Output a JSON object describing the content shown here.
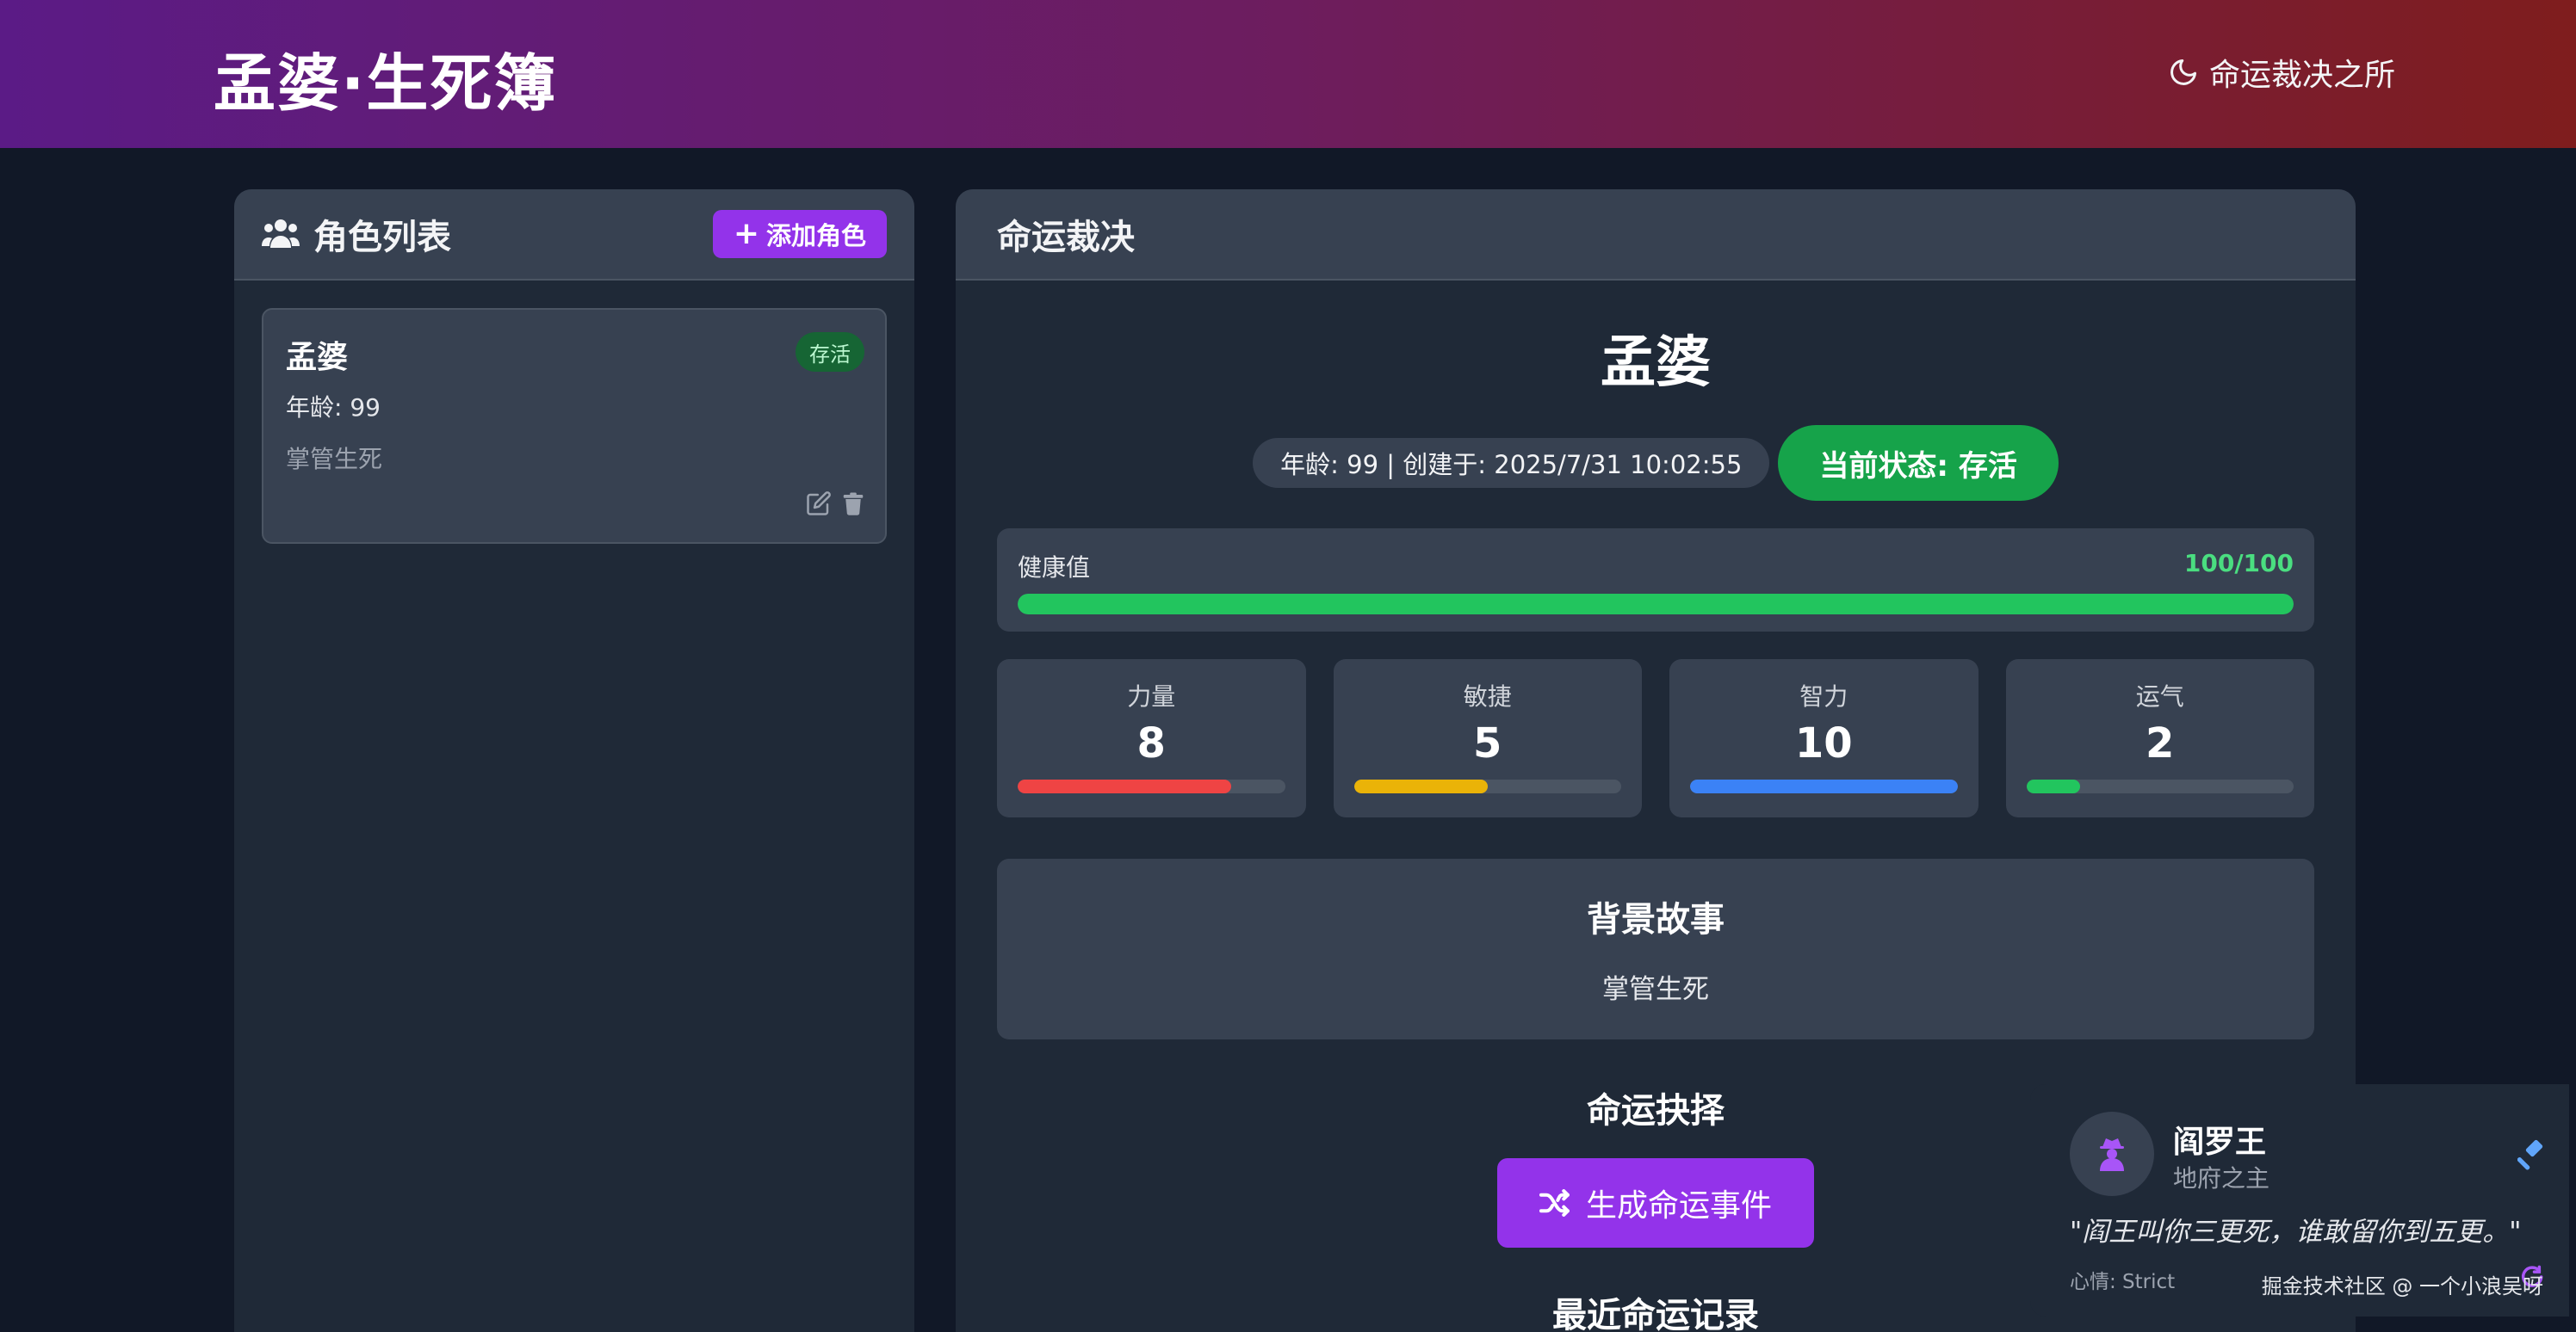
{
  "header": {
    "brand": "孟婆·生死簿",
    "nav_label": "命运裁决之所"
  },
  "left_panel": {
    "title": "角色列表",
    "add_button": "添加角色",
    "character": {
      "name": "孟婆",
      "status": "存活",
      "age": "年龄: 99",
      "description": "掌管生死"
    }
  },
  "right_panel": {
    "title": "命运裁决",
    "name": "孟婆",
    "meta": "年龄: 99 | 创建于: 2025/7/31 10:02:55",
    "status": "当前状态: 存活",
    "health": {
      "label": "健康值",
      "value": "100/100",
      "percent": 100,
      "color": "#22c55e"
    },
    "stats": [
      {
        "label": "力量",
        "value": "8",
        "percent": 80,
        "color": "#ef4444"
      },
      {
        "label": "敏捷",
        "value": "5",
        "percent": 50,
        "color": "#eab308"
      },
      {
        "label": "智力",
        "value": "10",
        "percent": 100,
        "color": "#3b82f6"
      },
      {
        "label": "运气",
        "value": "2",
        "percent": 20,
        "color": "#22c55e"
      }
    ],
    "story_title": "背景故事",
    "story_text": "掌管生死",
    "choice_title": "命运抉择",
    "generate_button": "生成命运事件",
    "recent_title": "最近命运记录"
  },
  "npc": {
    "name": "阎罗王",
    "role": "地府之主",
    "quote": "\"阎王叫你三更死，谁敢留你到五更。\"",
    "mood": "心情: Strict"
  },
  "watermark": "掘金技术社区 @ 一个小浪吴呀",
  "colors": {
    "accent": "#9333ea",
    "status_green": "#16a34a",
    "panel_bg": "#1f2937",
    "card_bg": "#374151"
  }
}
